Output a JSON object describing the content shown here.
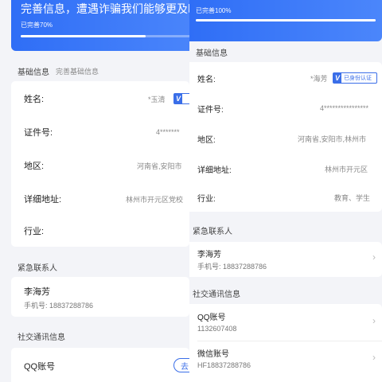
{
  "left": {
    "banner": {
      "title": "完善信息，遭遇诈骗我们能够更及时的",
      "progress_label": "已完善70%",
      "progress": 0.7
    },
    "basic": {
      "title": "基础信息",
      "subtitle": "完善基础信息"
    },
    "rows": [
      {
        "label": "姓名:",
        "value": "*玉清"
      },
      {
        "label": "证件号:",
        "value": "4*******"
      },
      {
        "label": "地区:",
        "value": "河南省,安阳市"
      },
      {
        "label": "详细地址:",
        "value": "林州市开元区党校"
      },
      {
        "label": "行业:",
        "value": ""
      }
    ],
    "cert_v": "V",
    "emergency": {
      "title": "紧急联系人",
      "name": "李海芳",
      "phone": "手机号: 18837288786"
    },
    "social": {
      "title": "社交通讯信息",
      "qq_label": "QQ账号",
      "go_button": "去"
    }
  },
  "right": {
    "banner": {
      "progress_label": "已完善100%",
      "progress": 1.0
    },
    "basic": {
      "title": "基础信息"
    },
    "rows": [
      {
        "label": "姓名:",
        "value": "*海芳"
      },
      {
        "label": "证件号:",
        "value": "4****************"
      },
      {
        "label": "地区:",
        "value": "河南省,安阳市,林州市"
      },
      {
        "label": "详细地址:",
        "value": "林州市开元区"
      },
      {
        "label": "行业:",
        "value": "教育、学生"
      }
    ],
    "cert": {
      "v": "V",
      "label": "已身份认证"
    },
    "emergency": {
      "title": "紧急联系人",
      "name": "李海芳",
      "phone": "手机号: 18837288786"
    },
    "social": {
      "title": "社交通讯信息",
      "items": [
        {
          "label": "QQ账号",
          "value": "1132607408"
        },
        {
          "label": "微信账号",
          "value": "HF18837288786"
        }
      ]
    }
  },
  "colors": {
    "accent": "#3a6ee8",
    "banner": "#2f6ef6",
    "background": "#f3f4f8"
  }
}
